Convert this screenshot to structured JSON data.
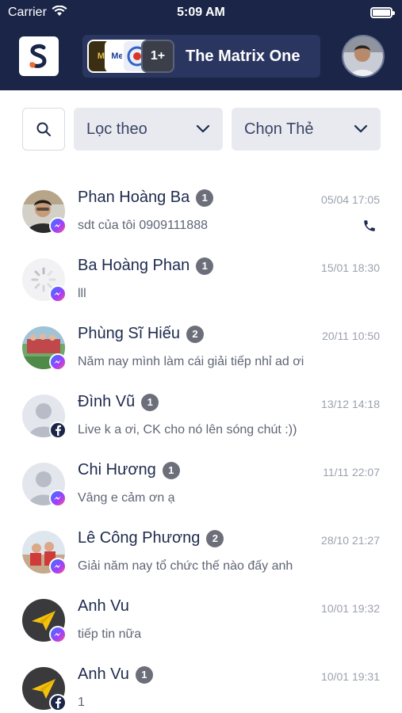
{
  "status_bar": {
    "carrier": "Carrier",
    "time": "5:09 AM"
  },
  "header": {
    "logo_letter": "S",
    "channel": {
      "name": "The Matrix One",
      "thumbs": [
        "MI",
        "Mes",
        "",
        "1+"
      ]
    }
  },
  "filters": {
    "filter_label": "Lọc theo",
    "tag_label": "Chọn Thẻ"
  },
  "conversations": [
    {
      "name": "Phan Hoàng Ba",
      "count": "1",
      "time": "05/04 17:05",
      "message": "sdt của tôi 0909111888",
      "platform": "messenger",
      "has_call": true
    },
    {
      "name": "Ba Hoàng Phan",
      "count": "1",
      "time": "15/01 18:30",
      "message": "lll",
      "platform": "messenger",
      "has_call": false
    },
    {
      "name": "Phùng Sĩ Hiếu",
      "count": "2",
      "time": "20/11 10:50",
      "message": "Năm nay mình làm cái giải tiếp nhỉ ad ơi",
      "platform": "messenger",
      "has_call": false
    },
    {
      "name": "Đình Vũ",
      "count": "1",
      "time": "13/12 14:18",
      "message": "Live k a ơi, CK cho nó lên sóng chút :))",
      "platform": "facebook",
      "has_call": false
    },
    {
      "name": "Chi Hương",
      "count": "1",
      "time": "11/11 22:07",
      "message": "Vâng e cảm ơn ạ",
      "platform": "messenger",
      "has_call": false
    },
    {
      "name": "Lê Công Phương",
      "count": "2",
      "time": "28/10 21:27",
      "message": "Giải năm nay tổ chức thế nào đấy anh",
      "platform": "messenger",
      "has_call": false
    },
    {
      "name": "Anh Vu",
      "count": "",
      "time": "10/01 19:32",
      "message": "tiếp tin nữa",
      "platform": "messenger",
      "has_call": false
    },
    {
      "name": "Anh Vu",
      "count": "1",
      "time": "10/01 19:31",
      "message": "1",
      "platform": "facebook",
      "has_call": false
    }
  ],
  "colors": {
    "header_bg": "#1a2547",
    "accent_orange": "#f26b2a",
    "badge_gray": "#6c6f7a"
  }
}
